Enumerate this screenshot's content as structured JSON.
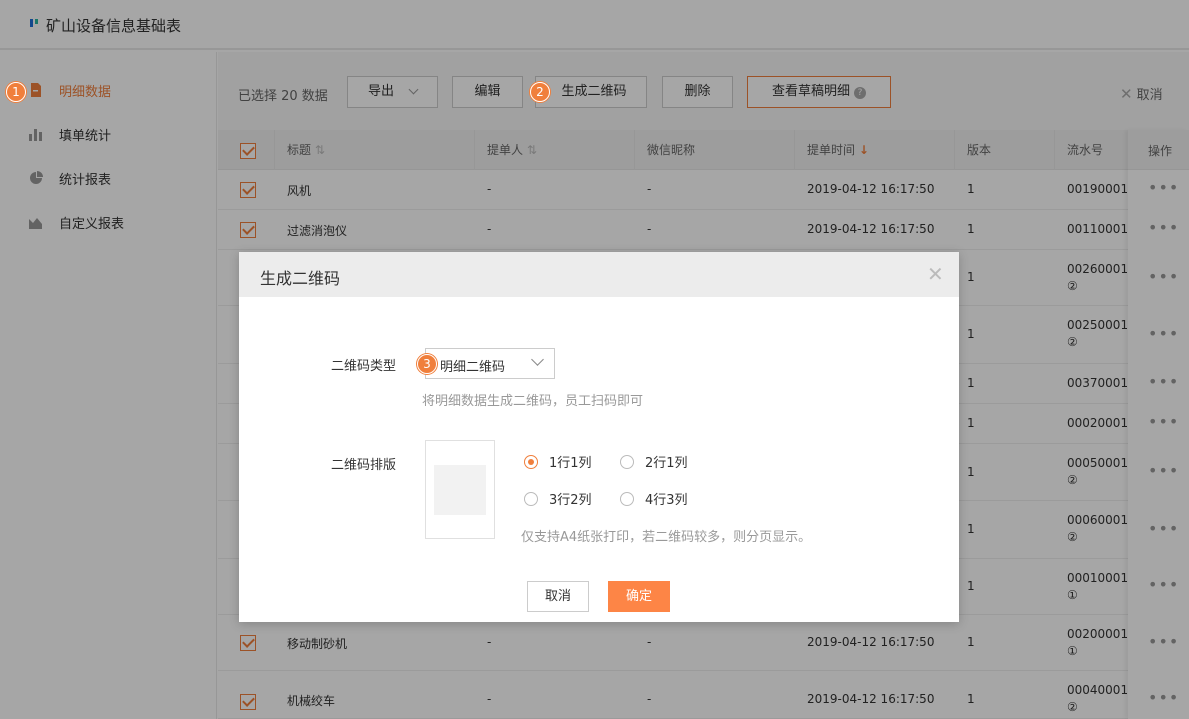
{
  "app": {
    "title": "矿山设备信息基础表"
  },
  "sidebar": {
    "items": [
      {
        "label": "明细数据",
        "active": true,
        "badge": "1"
      },
      {
        "label": "填单统计",
        "active": false
      },
      {
        "label": "统计报表",
        "active": false
      },
      {
        "label": "自定义报表",
        "active": false
      }
    ]
  },
  "toolbar": {
    "selected_text": "已选择 20 数据",
    "export_label": "导出",
    "edit_label": "编辑",
    "qrcode_label": "生成二维码",
    "qrcode_badge": "2",
    "delete_label": "删除",
    "draft_label": "查看草稿明细",
    "help_glyph": "?",
    "cancel_label": "取消"
  },
  "table": {
    "headers": {
      "title": "标题",
      "submitter": "提单人",
      "wechat": "微信昵称",
      "time": "提单时间",
      "version": "版本",
      "serial": "流水号",
      "ops": "操作"
    },
    "rows": [
      {
        "title": "风机",
        "submitter": "-",
        "wechat": "-",
        "time": "2019-04-12 16:17:50",
        "version": "1",
        "serial": "00190001:"
      },
      {
        "title": "过滤消泡仪",
        "submitter": "-",
        "wechat": "-",
        "time": "2019-04-12 16:17:50",
        "version": "1",
        "serial": "00110001"
      },
      {
        "title": "",
        "submitter": "",
        "wechat": "",
        "time": "",
        "version": "1",
        "serial": "00260001:",
        "serial2": "②"
      },
      {
        "title": "",
        "submitter": "",
        "wechat": "",
        "time": "",
        "version": "1",
        "serial": "00250001:",
        "serial2": "②"
      },
      {
        "title": "",
        "submitter": "",
        "wechat": "",
        "time": "",
        "version": "1",
        "serial": "00370001:"
      },
      {
        "title": "",
        "submitter": "",
        "wechat": "",
        "time": "",
        "version": "1",
        "serial": "00020001:"
      },
      {
        "title": "",
        "submitter": "",
        "wechat": "",
        "time": "",
        "version": "1",
        "serial": "00050001-",
        "serial2": "②"
      },
      {
        "title": "",
        "submitter": "",
        "wechat": "",
        "time": "",
        "version": "1",
        "serial": "00060001:",
        "serial2": "②"
      },
      {
        "title": "",
        "submitter": "",
        "wechat": "",
        "time": "",
        "version": "1",
        "serial": "00010001-",
        "serial2": "①"
      },
      {
        "title": "移动制砂机",
        "submitter": "-",
        "wechat": "-",
        "time": "2019-04-12 16:17:50",
        "version": "1",
        "serial": "00200001-",
        "serial2": "①"
      },
      {
        "title": "机械绞车",
        "submitter": "-",
        "wechat": "-",
        "time": "2019-04-12 16:17:50",
        "version": "1",
        "serial": "00040001-",
        "serial2": "②"
      }
    ]
  },
  "modal": {
    "title": "生成二维码",
    "type_label": "二维码类型",
    "type_value": "明细二维码",
    "type_badge": "3",
    "type_hint": "将明细数据生成二维码，员工扫码即可",
    "layout_label": "二维码排版",
    "layout_options": [
      "1行1列",
      "2行1列",
      "3行2列",
      "4行3列"
    ],
    "layout_selected": "1行1列",
    "layout_hint": "仅支持A4纸张打印，若二维码较多，则分页显示。",
    "cancel_label": "取消",
    "ok_label": "确定"
  },
  "colors": {
    "accent": "#f07f3c",
    "ok_button": "#fd8546"
  }
}
